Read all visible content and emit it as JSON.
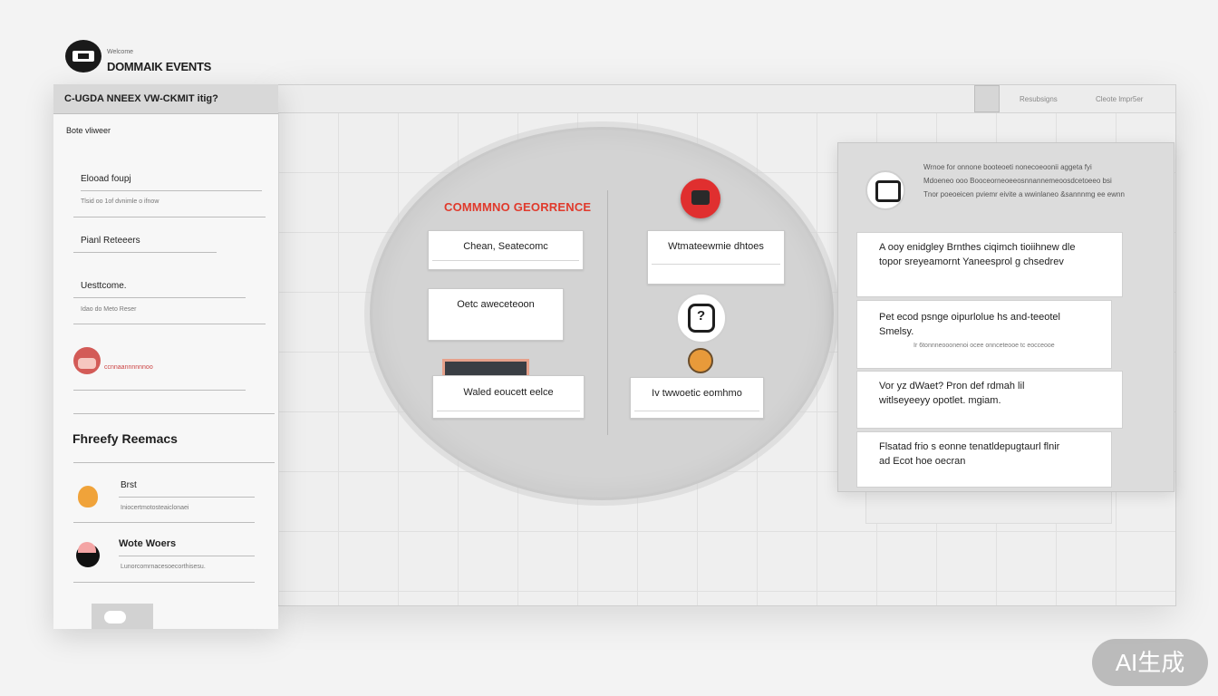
{
  "brand": {
    "subtitle": "Welcome",
    "title": "DOMMAIK EVENTS"
  },
  "topbar": {
    "link1": "Resubsigns",
    "link2": "Cleote lmpr5er"
  },
  "sidebar": {
    "header": "C-UGDA NNEEX VW-CKMIT itig?",
    "subheader": "Bote vliweer",
    "item1": {
      "label": "Elooad foupj",
      "detail": "Tlsid oo 1of dvnimle o ifnow"
    },
    "item2": {
      "label": "Pianl Reteeers"
    },
    "item3": {
      "label": "Uesttcome.",
      "detail": "Idao do Meto Reser"
    },
    "item4": {
      "detail": "ccnnaannnnnnoo"
    },
    "section": "Fhreefy Reemacs",
    "item5": {
      "label": "Brst",
      "detail": "Iniocertmotosteaiclonaei"
    },
    "item6": {
      "label": "Wote Woers",
      "detail": "Lunorcomrnacesoecorthisesu."
    }
  },
  "diagram": {
    "title": "COMMMNO GEORRENCE",
    "card1": "Chean, Seatecomc",
    "card2": "Oetc aweceteoon",
    "card3": "Waled eoucett eelce",
    "card4": "Wtmateewmie dhtoes",
    "card5": "Iv twwoetic eomhmo"
  },
  "panel": {
    "desc1": "Wrnoe for onnone booteoeti nonecoeoonii aggeta fyi",
    "desc2": "Mdoeneo ooo Booceorneoeeosnnannemeoosdcetoeeo bsi",
    "desc3": "Tnor poeoeicen pviemr eivite a  wwinlaneo &sannnmg ee ewnn",
    "card1_line1": "A ooy enidgley Brnthes ciqimch tioiihnew dle",
    "card1_line2": "topor sreyeamornt Yaneesprol g chsedrev",
    "card2_line1": "Pet ecod psnge oipurlolue hs and-teeotel",
    "card2_line2": "Smelsy.",
    "card2_detail": "Ir 6tonnneooonenoi ocee onnceteooe tc eocceooe",
    "card3_line1": "Vor yz dWaet? Pron def rdmah lil",
    "card3_line2": "witlseyeeyy opotlet. mgiam.",
    "card4_line1": "Flsatad frio s eonne tenatldepugtaurl flnir",
    "card4_line2": "ad Ecot hoe oecran"
  },
  "watermark": "AI生成",
  "colors": {
    "accent": "#e03a2c",
    "panel": "#dcdcdc",
    "ellipse": "#d3d3d3"
  }
}
